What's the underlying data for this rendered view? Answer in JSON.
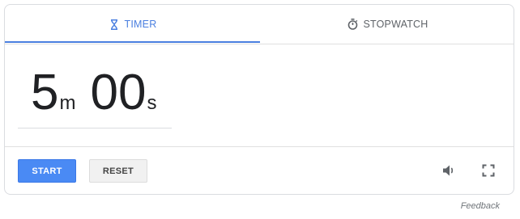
{
  "tabs": [
    {
      "label": "TIMER",
      "icon": "hourglass-icon",
      "active": true
    },
    {
      "label": "STOPWATCH",
      "icon": "stopwatch-icon",
      "active": false
    }
  ],
  "timer": {
    "minutes": "5",
    "minutes_unit": "m",
    "seconds": "00",
    "seconds_unit": "s"
  },
  "actions": {
    "start_label": "START",
    "reset_label": "RESET"
  },
  "controls": {
    "volume_icon": "volume-icon",
    "fullscreen_icon": "fullscreen-icon"
  },
  "footer": {
    "feedback": "Feedback"
  },
  "colors": {
    "accent": "#4a7fe0",
    "start_button": "#4a8af4",
    "reset_button": "#f1f1f1",
    "text": "#202124"
  }
}
